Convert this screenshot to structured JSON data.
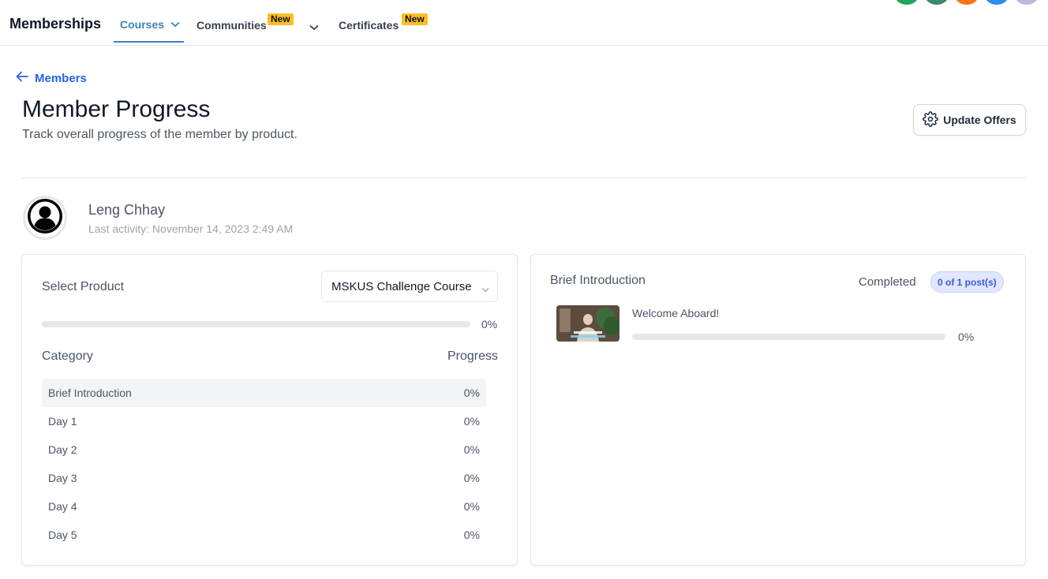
{
  "nav": {
    "brand": "Memberships",
    "tabs": [
      {
        "label": "Courses",
        "active": true
      },
      {
        "label": "Communities",
        "badge": "New"
      },
      {
        "label": "Certificates",
        "badge": "New"
      }
    ]
  },
  "header": {
    "back_label": "Members",
    "title": "Member Progress",
    "subtitle": "Track overall progress of the member by product.",
    "update_button": "Update Offers"
  },
  "member": {
    "name": "Leng Chhay",
    "last_activity": "Last activity: November 14, 2023 2:49 AM"
  },
  "left_panel": {
    "select_label": "Select Product",
    "selected_product": "MSKUS Challenge Course",
    "overall_progress": 0,
    "overall_progress_label": "0%",
    "category_header": "Category",
    "progress_header": "Progress",
    "categories": [
      {
        "name": "Brief Introduction",
        "progress": "0%",
        "selected": true
      },
      {
        "name": "Day 1",
        "progress": "0%"
      },
      {
        "name": "Day 2",
        "progress": "0%"
      },
      {
        "name": "Day 3",
        "progress": "0%"
      },
      {
        "name": "Day 4",
        "progress": "0%"
      },
      {
        "name": "Day 5",
        "progress": "0%"
      }
    ]
  },
  "right_panel": {
    "title": "Brief Introduction",
    "completed_label": "Completed",
    "completed_count": "0 of 1 post(s)",
    "posts": [
      {
        "title": "Welcome Aboard!",
        "progress": 0,
        "progress_label": "0%"
      }
    ]
  },
  "colors": {
    "accent": "#3b82c4",
    "link": "#2563eb",
    "badge": "#fbbf24",
    "avatar_dots": [
      "#22a55b",
      "#3a8a6b",
      "#f97316",
      "#2b8ff0",
      "#c4b5d6"
    ]
  }
}
